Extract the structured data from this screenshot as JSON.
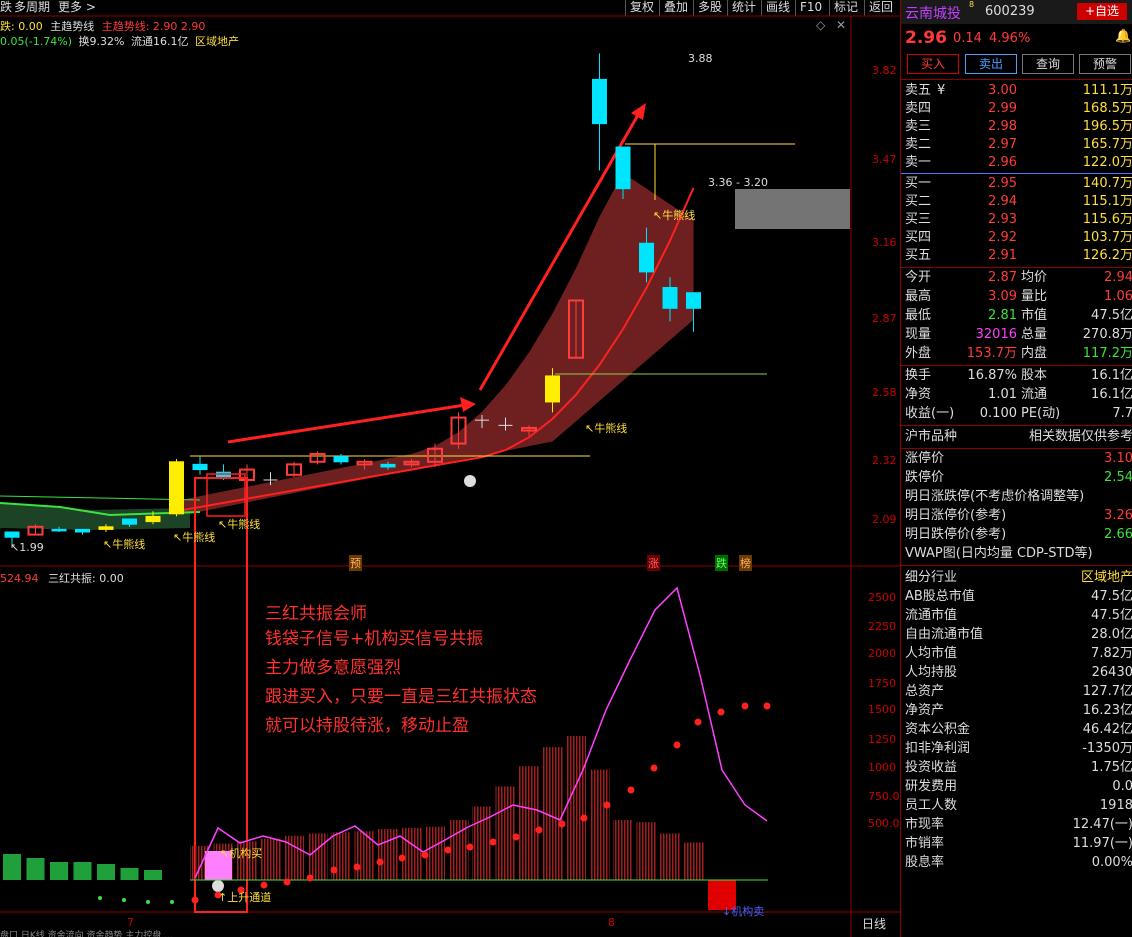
{
  "topbar": {
    "left_items": [
      "跌",
      "多周期",
      "更多 >"
    ],
    "buttons": [
      "复权",
      "叠加",
      "多股",
      "统计",
      "画线",
      "F10",
      "标记",
      "返回"
    ]
  },
  "indicator_line1": {
    "prefix": "跌: 0.00",
    "main_label": "主趋势线",
    "main_value_label": "主趋势线: 2.90",
    "main_value2": "2.90"
  },
  "indicator_line2": {
    "change": "0.05(-1.74%)",
    "turnover": "换9.32%",
    "float": "流通16.1亿",
    "sector": "区域地产"
  },
  "chart_data": [
    {
      "type": "candlestick",
      "title": "",
      "price_ticks": [
        "3.82",
        "3.47",
        "3.16",
        "2.87",
        "2.58",
        "2.32",
        "2.09"
      ],
      "annotations": [
        "3.88",
        "3.36 - 3.20",
        "牛熊线",
        "牛熊线",
        "牛熊线",
        "牛熊线",
        "牛熊线",
        "1.99"
      ],
      "event_markers": [
        "预",
        "涨",
        "跌",
        "榜"
      ],
      "candles": [
        {
          "o": 2.02,
          "h": 2.04,
          "l": 1.99,
          "c": 2.04,
          "color": "cyan"
        },
        {
          "o": 2.06,
          "h": 2.07,
          "l": 2.03,
          "c": 2.03,
          "color": "red"
        },
        {
          "o": 2.05,
          "h": 2.06,
          "l": 2.04,
          "c": 2.05,
          "color": "cyan"
        },
        {
          "o": 2.04,
          "h": 2.05,
          "l": 2.03,
          "c": 2.05,
          "color": "cyan"
        },
        {
          "o": 2.05,
          "h": 2.07,
          "l": 2.04,
          "c": 2.06,
          "color": "yellow"
        },
        {
          "o": 2.07,
          "h": 2.09,
          "l": 2.06,
          "c": 2.09,
          "color": "cyan"
        },
        {
          "o": 2.08,
          "h": 2.12,
          "l": 2.07,
          "c": 2.1,
          "color": "yellow"
        },
        {
          "o": 2.11,
          "h": 2.32,
          "l": 2.1,
          "c": 2.31,
          "color": "yellow"
        },
        {
          "o": 2.3,
          "h": 2.33,
          "l": 2.26,
          "c": 2.28,
          "color": "cyan"
        },
        {
          "o": 2.27,
          "h": 2.3,
          "l": 2.24,
          "c": 2.25,
          "color": "cyan"
        },
        {
          "o": 2.24,
          "h": 2.3,
          "l": 2.22,
          "c": 2.28,
          "color": "red"
        },
        {
          "o": 2.24,
          "h": 2.27,
          "l": 2.22,
          "c": 2.24,
          "color": "cross"
        },
        {
          "o": 2.26,
          "h": 2.31,
          "l": 2.25,
          "c": 2.3,
          "color": "red"
        },
        {
          "o": 2.31,
          "h": 2.35,
          "l": 2.3,
          "c": 2.34,
          "color": "red"
        },
        {
          "o": 2.33,
          "h": 2.34,
          "l": 2.3,
          "c": 2.31,
          "color": "cyan"
        },
        {
          "o": 2.3,
          "h": 2.32,
          "l": 2.28,
          "c": 2.31,
          "color": "red"
        },
        {
          "o": 2.3,
          "h": 2.31,
          "l": 2.28,
          "c": 2.29,
          "color": "cyan"
        },
        {
          "o": 2.3,
          "h": 2.32,
          "l": 2.29,
          "c": 2.31,
          "color": "red"
        },
        {
          "o": 2.31,
          "h": 2.38,
          "l": 2.29,
          "c": 2.36,
          "color": "red"
        },
        {
          "o": 2.38,
          "h": 2.5,
          "l": 2.36,
          "c": 2.48,
          "color": "red"
        },
        {
          "o": 2.47,
          "h": 2.49,
          "l": 2.44,
          "c": 2.46,
          "color": "cross"
        },
        {
          "o": 2.45,
          "h": 2.48,
          "l": 2.43,
          "c": 2.45,
          "color": "cross"
        },
        {
          "o": 2.43,
          "h": 2.45,
          "l": 2.41,
          "c": 2.44,
          "color": "red"
        },
        {
          "o": 2.54,
          "h": 2.67,
          "l": 2.5,
          "c": 2.64,
          "color": "yellow"
        },
        {
          "o": 2.71,
          "h": 2.93,
          "l": 2.71,
          "c": 2.93,
          "color": "red"
        },
        {
          "o": 3.78,
          "h": 3.88,
          "l": 3.43,
          "c": 3.61,
          "color": "cyan"
        },
        {
          "o": 3.52,
          "h": 3.52,
          "l": 3.32,
          "c": 3.36,
          "color": "cyan"
        },
        {
          "o": 3.15,
          "h": 3.21,
          "l": 3.0,
          "c": 3.04,
          "color": "cyan"
        },
        {
          "o": 2.98,
          "h": 3.02,
          "l": 2.85,
          "c": 2.9,
          "color": "cyan"
        },
        {
          "o": 2.9,
          "h": 2.92,
          "l": 2.81,
          "c": 2.96,
          "color": "cyan"
        }
      ]
    },
    {
      "type": "bar",
      "title": "三红共振",
      "header_value": "524.94",
      "header_label": "三红共振: 0.00",
      "y_ticks": [
        "2500",
        "2250",
        "2000",
        "1750",
        "1500",
        "1250",
        "1000",
        "750.0",
        "500.0"
      ],
      "labels": [
        "机构买",
        "上升通道",
        "机构卖"
      ],
      "x_labels": [
        "7",
        "8"
      ],
      "period_label": "日线"
    }
  ],
  "annotation": {
    "lines": [
      "三红共振会师",
      "钱袋子信号+机构买信号共振",
      "主力做多意愿强烈",
      "跟进买入，只要一直是三红共振状态",
      "就可以持股待涨，移动止盈"
    ]
  },
  "bottom_strip": "盘口  日K线  资金流向  资金趋势  主力控盘  ...",
  "stock": {
    "name": "云南城投",
    "badge": "8",
    "code": "600239",
    "add_label": "+自选",
    "price": "2.96",
    "change": "0.14",
    "pct": "4.96%",
    "bell": "🔔",
    "buttons": [
      "买入",
      "卖出",
      "查询",
      "预警"
    ]
  },
  "asks": [
    {
      "label": "卖五",
      "sym": "¥",
      "price": "3.00",
      "vol": "111.1万"
    },
    {
      "label": "卖四",
      "sym": "",
      "price": "2.99",
      "vol": "168.5万"
    },
    {
      "label": "卖三",
      "sym": "",
      "price": "2.98",
      "vol": "196.5万"
    },
    {
      "label": "卖二",
      "sym": "",
      "price": "2.97",
      "vol": "165.7万"
    },
    {
      "label": "卖一",
      "sym": "",
      "price": "2.96",
      "vol": "122.0万"
    }
  ],
  "bids": [
    {
      "label": "买一",
      "price": "2.95",
      "vol": "140.7万"
    },
    {
      "label": "买二",
      "price": "2.94",
      "vol": "115.1万"
    },
    {
      "label": "买三",
      "price": "2.93",
      "vol": "115.6万"
    },
    {
      "label": "买四",
      "price": "2.92",
      "vol": "103.7万"
    },
    {
      "label": "买五",
      "price": "2.91",
      "vol": "126.2万"
    }
  ],
  "quote": [
    {
      "k1": "今开",
      "v1": "2.87",
      "c1": "red",
      "k2": "均价",
      "v2": "2.94",
      "c2": "red"
    },
    {
      "k1": "最高",
      "v1": "3.09",
      "c1": "red",
      "k2": "量比",
      "v2": "1.06",
      "c2": "red"
    },
    {
      "k1": "最低",
      "v1": "2.81",
      "c1": "grn",
      "k2": "市值",
      "v2": "47.5亿",
      "c2": "wht"
    },
    {
      "k1": "现量",
      "v1": "32016",
      "c1": "pur",
      "k2": "总量",
      "v2": "270.8万",
      "c2": "wht"
    },
    {
      "k1": "外盘",
      "v1": "153.7万",
      "c1": "red",
      "k2": "内盘",
      "v2": "117.2万",
      "c2": "grn"
    }
  ],
  "quote2": [
    {
      "k1": "换手",
      "v1": "16.87%",
      "k2": "股本",
      "v2": "16.1亿"
    },
    {
      "k1": "净资",
      "v1": "1.01",
      "k2": "流通",
      "v2": "16.1亿"
    },
    {
      "k1": "收益(一)",
      "v1": "0.100",
      "k2": "PE(动)",
      "v2": "7.7"
    }
  ],
  "market": {
    "left": "沪市品种",
    "right": "相关数据仅供参考"
  },
  "limit": [
    {
      "k": "涨停价",
      "v": "3.10",
      "c": "red"
    },
    {
      "k": "跌停价",
      "v": "2.54",
      "c": "grn"
    },
    {
      "k": "明日涨跌停(不考虑价格调整等)",
      "v": "",
      "c": "wht"
    },
    {
      "k": "明日涨停价(参考)",
      "v": "3.26",
      "c": "red"
    },
    {
      "k": "明日跌停价(参考)",
      "v": "2.66",
      "c": "grn"
    },
    {
      "k": "VWAP图(日内均量 CDP-STD等)",
      "v": "",
      "c": "wht"
    }
  ],
  "fundamentals": [
    {
      "k": "细分行业",
      "v": "区域地产",
      "c": "yel"
    },
    {
      "k": "AB股总市值",
      "v": "47.5亿",
      "c": "wht"
    },
    {
      "k": "流通市值",
      "v": "47.5亿",
      "c": "wht"
    },
    {
      "k": "自由流通市值",
      "v": "28.0亿",
      "c": "wht"
    },
    {
      "k": "人均市值",
      "v": "7.82万",
      "c": "wht"
    },
    {
      "k": "人均持股",
      "v": "26430",
      "c": "wht"
    },
    {
      "k": "总资产",
      "v": "127.7亿",
      "c": "wht"
    },
    {
      "k": "净资产",
      "v": "16.23亿",
      "c": "wht"
    },
    {
      "k": "资本公积金",
      "v": "46.42亿",
      "c": "wht"
    },
    {
      "k": "扣非净利润",
      "v": "-1350万",
      "c": "wht"
    },
    {
      "k": "投资收益",
      "v": "1.75亿",
      "c": "wht"
    },
    {
      "k": "研发费用",
      "v": "0.0",
      "c": "wht"
    },
    {
      "k": "员工人数",
      "v": "1918",
      "c": "wht"
    },
    {
      "k": "市现率",
      "v": "12.47(一)",
      "c": "wht"
    },
    {
      "k": "市销率",
      "v": "11.97(一)",
      "c": "wht"
    },
    {
      "k": "股息率",
      "v": "0.00%",
      "c": "wht"
    }
  ],
  "colors": {
    "up": "#ff3b3b",
    "down": "#00e5ff",
    "accent": "#ffdf3c",
    "band": "#8b2a2a"
  }
}
